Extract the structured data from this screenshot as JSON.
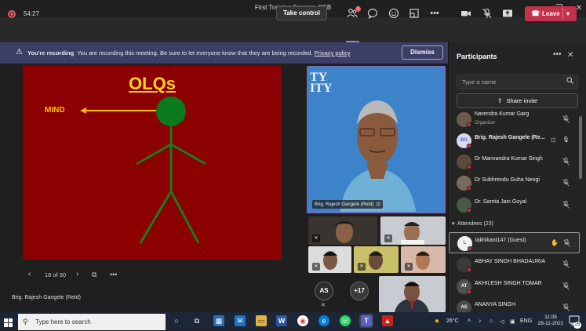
{
  "window": {
    "title": "First Training Session_SSB"
  },
  "toolbar": {
    "timer": "54:27",
    "take_control": "Take control",
    "participants_badge": "1",
    "leave_label": "Leave"
  },
  "banner": {
    "heading": "You're recording",
    "message": "You are recording this meeting. Be sure to let everyone know that they are being recorded.",
    "link": "Privacy policy",
    "dismiss": "Dismiss"
  },
  "slide": {
    "title": "OLQs",
    "mind_label": "MIND",
    "page": "18 of 30",
    "presenter": "Brig. Rajesh Gangele (Retd)",
    "colors": {
      "background": "#8b0000",
      "title": "#ffd21f",
      "head": "#0b7a1c",
      "body": "#1e7a1e",
      "arrow": "#ffc000"
    }
  },
  "video": {
    "main_name": "Brig. Rajesh Gangele (Retd)",
    "main_bg_letters": "TY\nITY",
    "as_initials": "AS",
    "more_count": "+17"
  },
  "participants": {
    "title": "Participants",
    "search_placeholder": "Type a name",
    "share_invite": "Share invite",
    "attendees_heading": "Attendees (23)",
    "presenters": [
      {
        "name": "Narendra Kumar Garg",
        "role": "Organizer",
        "initials": "",
        "bold": false,
        "avatar_color": "#6d5a4a"
      },
      {
        "name": "Brig. Rajesh Gangele (Re...",
        "role": "",
        "initials": "BG",
        "bold": true,
        "avatar_color": "#d9d9ef"
      },
      {
        "name": "Dr Manvandra Kumar Singh",
        "role": "",
        "initials": "",
        "bold": false,
        "avatar_color": "#5a4a3a"
      },
      {
        "name": "Dr Subhrendu Guha Neogi",
        "role": "",
        "initials": "",
        "bold": false,
        "avatar_color": "#7a6a5a"
      },
      {
        "name": "Dr. Samta Jain Goyal",
        "role": "",
        "initials": "",
        "bold": false,
        "avatar_color": "#4a5a4a"
      }
    ],
    "attendees": [
      {
        "name": "lakhikant147 (Guest)",
        "initials": "L",
        "avatar_color": "#f2f2f2"
      },
      {
        "name": "ABHAY SINGH BHADAURIA",
        "initials": "",
        "avatar_color": "#3a3a3a"
      },
      {
        "name": "AKHILESH SINGH TOMAR",
        "initials": "AT",
        "avatar_color": "#505050"
      },
      {
        "name": "ANANYA SINGH",
        "initials": "AS",
        "avatar_color": "#4a4a4a"
      }
    ]
  },
  "taskbar": {
    "search_placeholder": "Type here to search",
    "weather": "26°C",
    "language": "ENG",
    "time": "11:05",
    "date": "28-11-2021",
    "notification_count": "25"
  }
}
